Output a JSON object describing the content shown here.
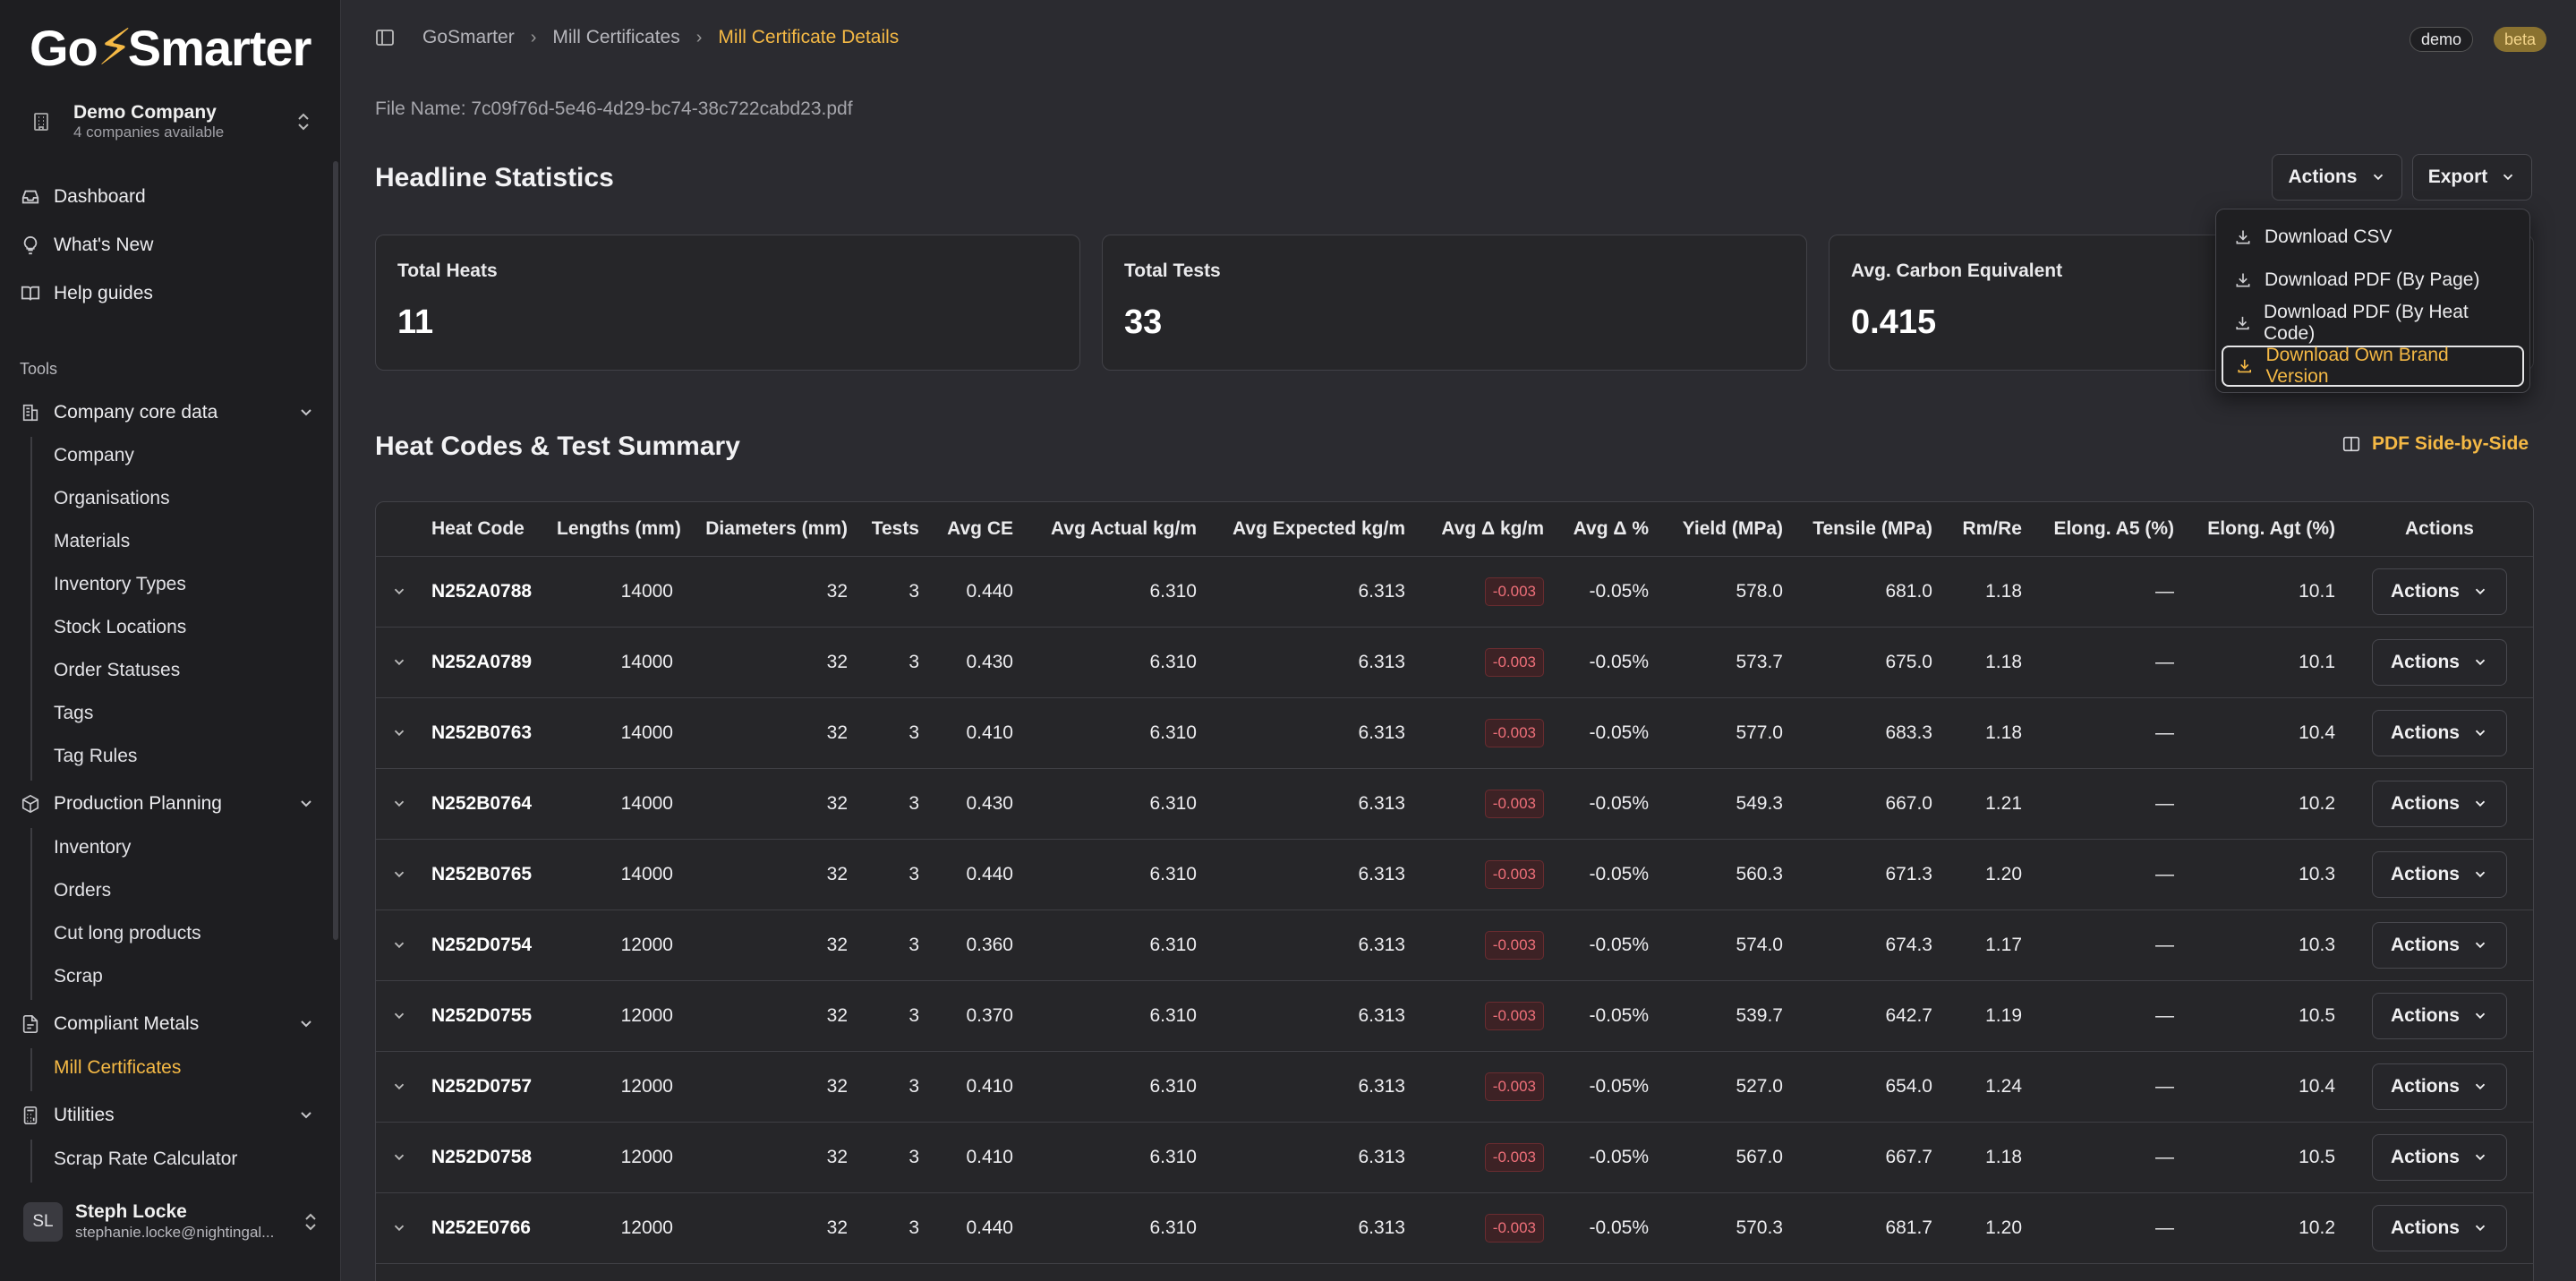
{
  "app": {
    "logo_text_left": "Go",
    "logo_text_bolt": "⚡",
    "logo_text_right": "Smarter"
  },
  "company": {
    "name": "Demo Company",
    "sub": "4 companies available"
  },
  "nav": {
    "dashboard": "Dashboard",
    "whats_new": "What's New",
    "help": "Help guides",
    "tools_label": "Tools",
    "core_data": "Company core data",
    "core_items": [
      "Company",
      "Organisations",
      "Materials",
      "Inventory Types",
      "Stock Locations",
      "Order Statuses",
      "Tags",
      "Tag Rules"
    ],
    "production": "Production Planning",
    "production_items": [
      "Inventory",
      "Orders",
      "Cut long products",
      "Scrap"
    ],
    "compliant": "Compliant Metals",
    "compliant_items": [
      "Mill Certificates"
    ],
    "utilities": "Utilities",
    "utilities_items": [
      "Scrap Rate Calculator"
    ]
  },
  "user": {
    "initials": "SL",
    "name": "Steph Locke",
    "email": "stephanie.locke@nightingal..."
  },
  "breadcrumb": {
    "root": "GoSmarter",
    "parent": "Mill Certificates",
    "current": "Mill Certificate Details"
  },
  "badges": {
    "demo": "demo",
    "beta": "beta"
  },
  "file_name": "File Name: 7c09f76d-5e46-4d29-bc74-38c722cabd23.pdf",
  "headline": {
    "title": "Headline Statistics",
    "actions_label": "Actions",
    "export_label": "Export",
    "cards": [
      {
        "title": "Total Heats",
        "value": "11"
      },
      {
        "title": "Total Tests",
        "value": "33"
      },
      {
        "title": "Avg. Carbon Equivalent",
        "value": "0.415"
      }
    ]
  },
  "export_menu": [
    "Download CSV",
    "Download PDF (By Page)",
    "Download PDF (By Heat Code)",
    "Download Own Brand Version"
  ],
  "summary": {
    "title": "Heat Codes & Test Summary",
    "pdf_side": "PDF Side-by-Side",
    "columns": [
      "Heat Code",
      "Lengths (mm)",
      "Diameters (mm)",
      "Tests",
      "Avg CE",
      "Avg Actual kg/m",
      "Avg Expected kg/m",
      "Avg Δ kg/m",
      "Avg Δ %",
      "Yield (MPa)",
      "Tensile (MPa)",
      "Rm/Re",
      "Elong. A5 (%)",
      "Elong. Agt (%)",
      "Actions"
    ],
    "row_action_label": "Actions",
    "rows": [
      [
        "N252A0788",
        "14000",
        "32",
        "3",
        "0.440",
        "6.310",
        "6.313",
        "-0.003",
        "-0.05%",
        "578.0",
        "681.0",
        "1.18",
        "—",
        "10.1"
      ],
      [
        "N252A0789",
        "14000",
        "32",
        "3",
        "0.430",
        "6.310",
        "6.313",
        "-0.003",
        "-0.05%",
        "573.7",
        "675.0",
        "1.18",
        "—",
        "10.1"
      ],
      [
        "N252B0763",
        "14000",
        "32",
        "3",
        "0.410",
        "6.310",
        "6.313",
        "-0.003",
        "-0.05%",
        "577.0",
        "683.3",
        "1.18",
        "—",
        "10.4"
      ],
      [
        "N252B0764",
        "14000",
        "32",
        "3",
        "0.430",
        "6.310",
        "6.313",
        "-0.003",
        "-0.05%",
        "549.3",
        "667.0",
        "1.21",
        "—",
        "10.2"
      ],
      [
        "N252B0765",
        "14000",
        "32",
        "3",
        "0.440",
        "6.310",
        "6.313",
        "-0.003",
        "-0.05%",
        "560.3",
        "671.3",
        "1.20",
        "—",
        "10.3"
      ],
      [
        "N252D0754",
        "12000",
        "32",
        "3",
        "0.360",
        "6.310",
        "6.313",
        "-0.003",
        "-0.05%",
        "574.0",
        "674.3",
        "1.17",
        "—",
        "10.3"
      ],
      [
        "N252D0755",
        "12000",
        "32",
        "3",
        "0.370",
        "6.310",
        "6.313",
        "-0.003",
        "-0.05%",
        "539.7",
        "642.7",
        "1.19",
        "—",
        "10.5"
      ],
      [
        "N252D0757",
        "12000",
        "32",
        "3",
        "0.410",
        "6.310",
        "6.313",
        "-0.003",
        "-0.05%",
        "527.0",
        "654.0",
        "1.24",
        "—",
        "10.4"
      ],
      [
        "N252D0758",
        "12000",
        "32",
        "3",
        "0.410",
        "6.310",
        "6.313",
        "-0.003",
        "-0.05%",
        "567.0",
        "667.7",
        "1.18",
        "—",
        "10.5"
      ],
      [
        "N252E0766",
        "12000",
        "32",
        "3",
        "0.440",
        "6.310",
        "6.313",
        "-0.003",
        "-0.05%",
        "570.3",
        "681.7",
        "1.20",
        "—",
        "10.2"
      ]
    ]
  },
  "colors": {
    "accent": "#f5b945",
    "background": "#2b2b30",
    "sidebar": "#1e1e21",
    "negative": "#f0707a"
  }
}
